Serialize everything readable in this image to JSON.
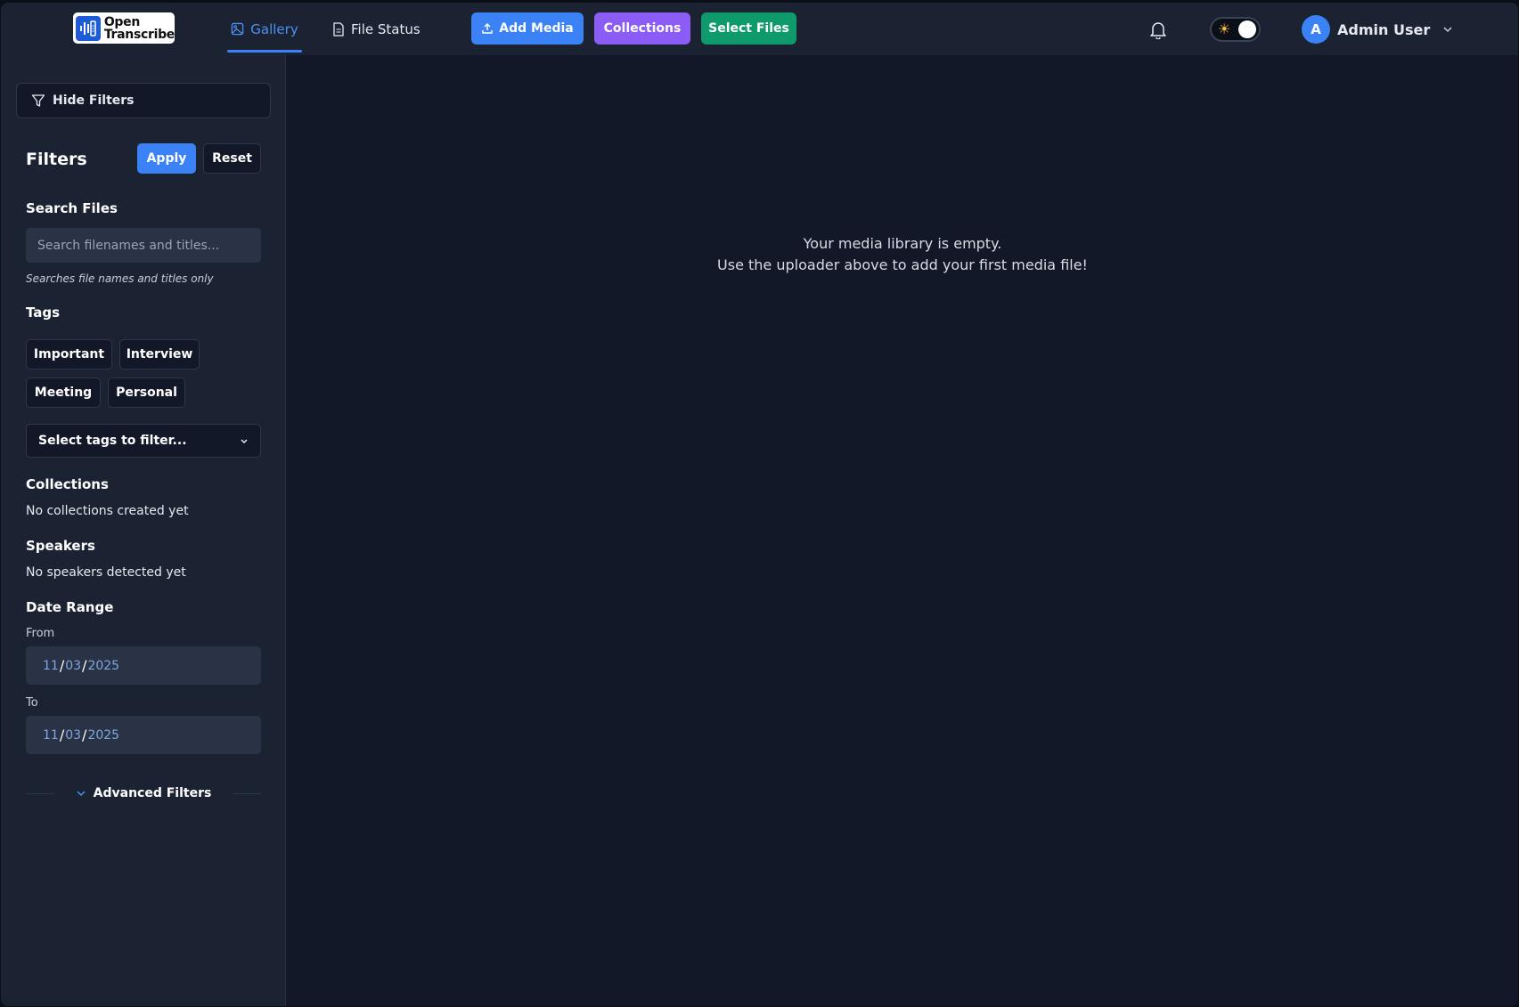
{
  "app": {
    "logo_line1": "Open",
    "logo_line2": "Transcribe"
  },
  "nav": {
    "tabs": [
      {
        "label": "Gallery",
        "icon": "image-icon",
        "active": true
      },
      {
        "label": "File Status",
        "icon": "document-icon",
        "active": false
      }
    ],
    "buttons": {
      "add_media": "Add Media",
      "collections": "Collections",
      "select_files": "Select Files"
    },
    "user_initial": "A",
    "user_name": "Admin User"
  },
  "colors": {
    "accent_blue": "#3b82f6",
    "collections_purple": "#8b5cf6",
    "select_green": "#0e9a6b"
  },
  "sidebar": {
    "hide_filters": "Hide Filters",
    "filters_title": "Filters",
    "apply": "Apply",
    "reset": "Reset",
    "search_title": "Search Files",
    "search_placeholder": "Search filenames and titles...",
    "search_hint": "Searches file names and titles only",
    "tags_title": "Tags",
    "tags": [
      "Important",
      "Interview",
      "Meeting",
      "Personal"
    ],
    "tag_select_placeholder": "Select tags to filter...",
    "collections_title": "Collections",
    "collections_empty": "No collections created yet",
    "speakers_title": "Speakers",
    "speakers_empty": "No speakers detected yet",
    "date_title": "Date Range",
    "from_label": "From",
    "from_date": {
      "month": "11",
      "day": "03",
      "year": "2025"
    },
    "to_label": "To",
    "to_date": {
      "month": "11",
      "day": "03",
      "year": "2025"
    },
    "advanced_filters": "Advanced Filters"
  },
  "main": {
    "empty_line1": "Your media library is empty.",
    "empty_line2": "Use the uploader above to add your first media file!"
  }
}
